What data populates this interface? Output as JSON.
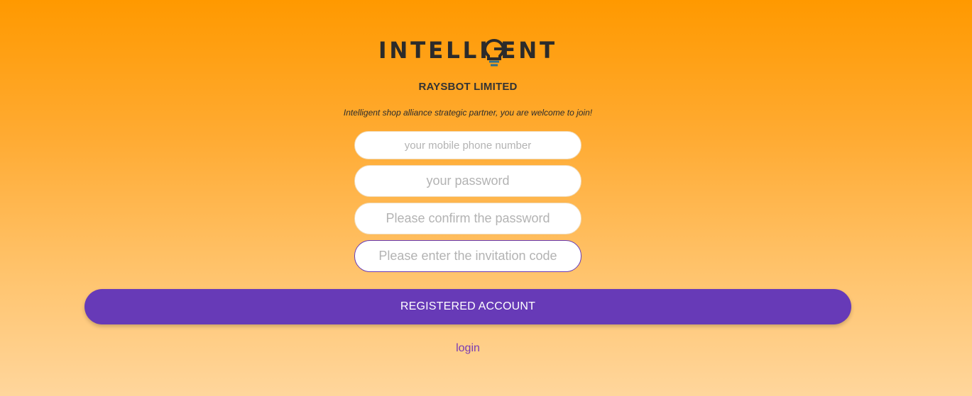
{
  "brand": {
    "logo_text": "INTELLIGENT",
    "company_name": "RAYSBOT LIMITED",
    "tagline": "Intelligent shop alliance strategic partner, you are welcome to join!"
  },
  "form": {
    "phone": {
      "placeholder": "your mobile phone number",
      "value": ""
    },
    "password": {
      "placeholder": "your password",
      "value": ""
    },
    "confirm_password": {
      "placeholder": "Please confirm the password",
      "value": ""
    },
    "invitation_code": {
      "placeholder": "Please enter the invitation code",
      "value": ""
    }
  },
  "actions": {
    "register_label": "REGISTERED ACCOUNT",
    "login_label": "login"
  },
  "colors": {
    "accent": "#673ab7",
    "logo_dark": "#2b2b2b",
    "logo_bulb": "#2d6f8e",
    "background_top": "#ff9900",
    "background_bottom": "#ffd69c"
  }
}
